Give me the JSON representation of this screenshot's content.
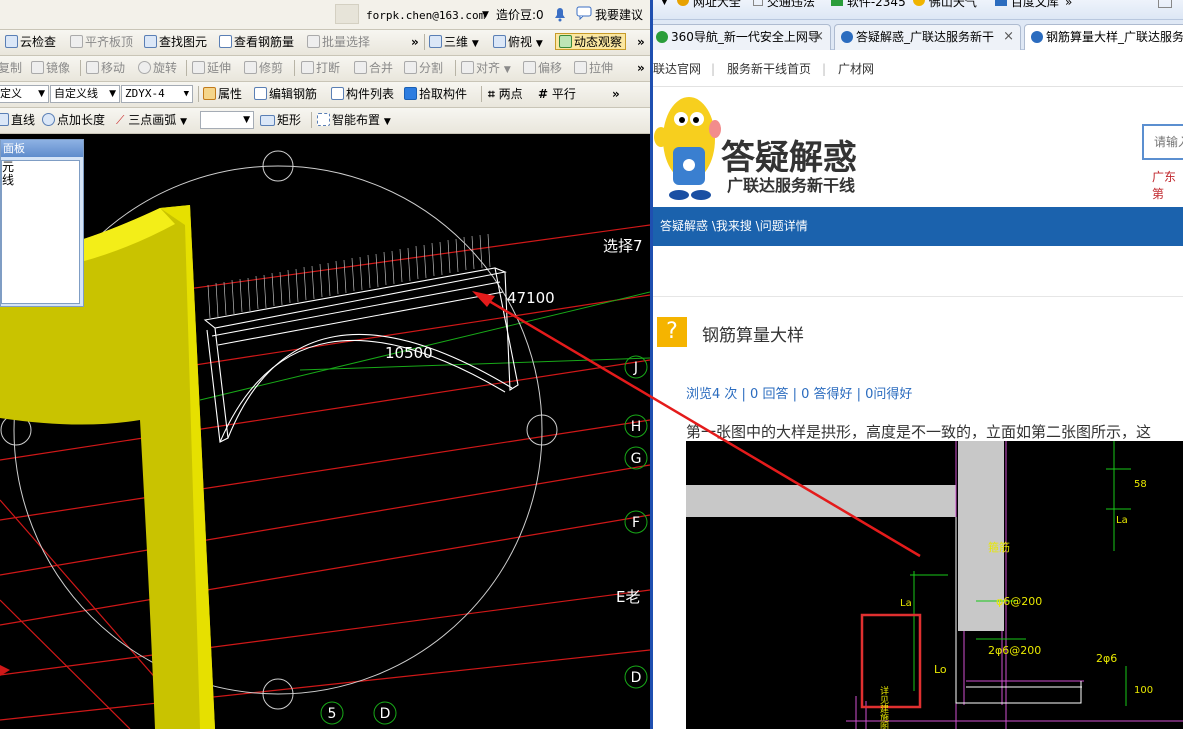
{
  "cad": {
    "top_bar": {
      "email": "forpk.chen@163.com",
      "beans": "造价豆:0",
      "suggest": "我要建议"
    },
    "toolbar1": {
      "cloud_check": "云检查",
      "align_top": "平齐板顶",
      "find_element": "查找图元",
      "view_rebar": "查看钢筋量",
      "batch_select": "批量选择",
      "view_3d": "三维",
      "top_view": "俯视",
      "dynamic_observe": "动态观察",
      "more": "»"
    },
    "toolbar2": {
      "copy": "复制",
      "mirror": "镜像",
      "move": "移动",
      "rotate": "旋转",
      "extend": "延伸",
      "trim": "修剪",
      "break": "打断",
      "merge": "合并",
      "split": "分割",
      "align": "对齐",
      "offset": "偏移",
      "stretch": "拉伸",
      "more": "»"
    },
    "toolbar3": {
      "combo_type": "定义",
      "combo_line": "自定义线",
      "combo_code": "ZDYX-4",
      "property": "属性",
      "edit_rebar": "编辑钢筋",
      "component_list": "构件列表",
      "pick_component": "拾取构件",
      "two_points": "两点",
      "parallel": "平行",
      "more": "»"
    },
    "toolbar4": {
      "line": "直线",
      "point_length": "点加长度",
      "three_point_arc": "三点画弧",
      "rectangle": "矩形",
      "smart_layout": "智能布置"
    },
    "panel": {
      "title": "面板",
      "line1": "元",
      "line2": "线"
    },
    "canvas": {
      "dim_47100": "47100",
      "dim_10500": "10500",
      "select_text": "选择7",
      "axis_labels": [
        "J",
        "H",
        "G",
        "F",
        "E",
        "D",
        "5",
        "D"
      ],
      "e_label": "E老"
    }
  },
  "browser": {
    "favorites": [
      {
        "label": "网址大全",
        "color": "#e8a200"
      },
      {
        "label": "交通违法",
        "color": "#888888"
      },
      {
        "label": "软件-2345",
        "color": "#2a9d3a"
      },
      {
        "label": "佛山天气",
        "color": "#f0b400"
      },
      {
        "label": "百度文库",
        "color": "#2b6cbf"
      }
    ],
    "tabs": [
      {
        "label": "360导航_新一代安全上网导",
        "icon_color": "#2a9d3a",
        "close": "×"
      },
      {
        "label": "答疑解惑_广联达服务新干",
        "icon_color": "#2b6cbf",
        "close": "×"
      },
      {
        "label": "钢筋算量大样_广联达服务",
        "icon_color": "#2b6cbf",
        "close": ""
      }
    ],
    "site_nav": [
      "联达官网",
      "服务新干线首页",
      "广材网"
    ],
    "banner": {
      "title": "答疑解惑",
      "subtitle": "广联达服务新干线",
      "search_placeholder": "请输入",
      "region": "广东第"
    },
    "breadcrumb": "答疑解惑 \\我来搜 \\问题详情",
    "question": {
      "title": "钢筋算量大样",
      "stats": "浏览4 次 | 0 回答 | 0 答得好 | 0问得好",
      "body": "第一张图中的大样是拱形，高度是不一致的，立面如第二张图所示，这"
    },
    "drawing": {
      "labels": [
        "箍筋",
        "φ6@200",
        "2φ6@200",
        "2φ6",
        "La",
        "Lo",
        "100",
        "58",
        "La",
        "详见建施图"
      ]
    }
  }
}
